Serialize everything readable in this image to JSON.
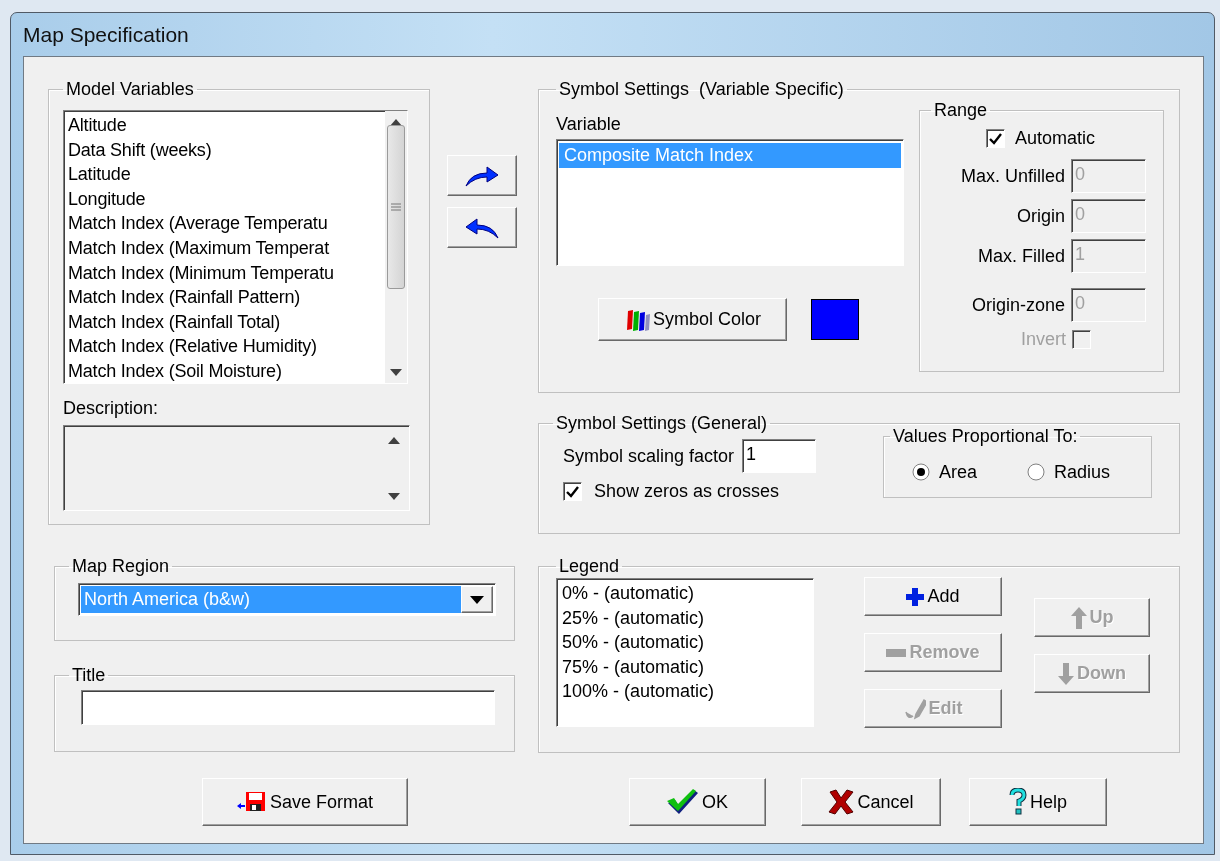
{
  "window": {
    "title": "Map Specification"
  },
  "model_variables": {
    "label": "Model Variables",
    "items": [
      {
        "text": "Altitude",
        "selected": false
      },
      {
        "text": "Data Shift (weeks)",
        "selected": false
      },
      {
        "text": "Latitude",
        "selected": false
      },
      {
        "text": "Longitude",
        "selected": false
      },
      {
        "text": "Match Index (Average Temperatu",
        "selected": false
      },
      {
        "text": "Match Index (Maximum Temperat",
        "selected": false
      },
      {
        "text": "Match Index (Minimum Temperatu",
        "selected": false
      },
      {
        "text": "Match Index (Rainfall Pattern)",
        "selected": false
      },
      {
        "text": "Match Index (Rainfall Total)",
        "selected": false
      },
      {
        "text": "Match Index (Relative Humidity)",
        "selected": false
      },
      {
        "text": "Match Index (Soil Moisture)",
        "selected": false
      }
    ],
    "description_label": "Description:"
  },
  "symbol_specific": {
    "label": "Symbol Settings  (Variable Specific)",
    "variable_label": "Variable",
    "variables": [
      {
        "text": "Composite Match Index",
        "selected": true
      }
    ],
    "symbol_color_button": "Symbol Color",
    "symbol_color": {
      "color": "#0000ff"
    },
    "range": {
      "label": "Range",
      "automatic": {
        "label": "Automatic",
        "checked": true
      },
      "fields": [
        {
          "label": "Max. Unfilled",
          "value": "0",
          "disabled": true
        },
        {
          "label": "Origin",
          "value": "0",
          "disabled": true
        },
        {
          "label": "Max. Filled",
          "value": "1",
          "disabled": true
        },
        {
          "label": "Origin-zone",
          "value": "0",
          "disabled": true
        }
      ],
      "invert": {
        "label": "Invert",
        "checked": false,
        "disabled": true
      }
    }
  },
  "symbol_general": {
    "label": "Symbol Settings (General)",
    "scaling_label": "Symbol scaling factor",
    "scaling_value": "1",
    "show_zeros": {
      "label": "Show zeros as crosses",
      "checked": true
    },
    "proportional": {
      "label": "Values Proportional To:",
      "options": [
        {
          "label": "Area",
          "selected": true
        },
        {
          "label": "Radius",
          "selected": false
        }
      ]
    }
  },
  "map_region": {
    "label": "Map Region",
    "value": "North America (b&w)",
    "selected": true
  },
  "title": {
    "label": "Title"
  },
  "legend": {
    "label": "Legend",
    "items": [
      "0% - (automatic)",
      "25% - (automatic)",
      "50% - (automatic)",
      "75% - (automatic)",
      "100% - (automatic)"
    ],
    "buttons": [
      {
        "kind": "add",
        "label": "Add",
        "disabled": false
      },
      {
        "kind": "remove",
        "label": "Remove",
        "disabled": true
      },
      {
        "kind": "edit",
        "label": "Edit",
        "disabled": true
      }
    ],
    "move_buttons": [
      {
        "kind": "up",
        "label": "Up",
        "disabled": true
      },
      {
        "kind": "down",
        "label": "Down",
        "disabled": true
      }
    ]
  },
  "footer_buttons": [
    {
      "kind": "save",
      "label": "Save Format"
    },
    {
      "kind": "ok",
      "label": "OK"
    },
    {
      "kind": "cancel",
      "label": "Cancel"
    },
    {
      "kind": "help",
      "label": "Help"
    }
  ]
}
